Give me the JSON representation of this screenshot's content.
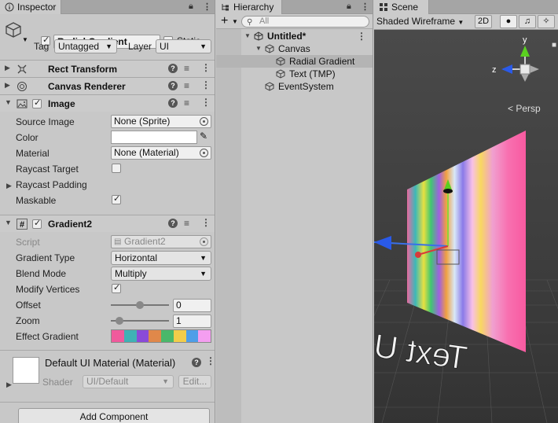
{
  "inspector": {
    "tab_label": "Inspector",
    "object_name": "Radial Gradient",
    "static_label": "Static",
    "tag_label": "Tag",
    "tag_value": "Untagged",
    "layer_label": "Layer",
    "layer_value": "UI",
    "components": [
      {
        "title": "Rect Transform",
        "expanded": false
      },
      {
        "title": "Canvas Renderer",
        "expanded": false
      },
      {
        "title": "Image",
        "expanded": true
      },
      {
        "title": "Gradient2",
        "expanded": true
      }
    ],
    "image": {
      "source_image_label": "Source Image",
      "source_image_value": "None (Sprite)",
      "color_label": "Color",
      "color_value": "#FFFFFF",
      "material_label": "Material",
      "material_value": "None (Material)",
      "raycast_target_label": "Raycast Target",
      "raycast_target_checked": false,
      "raycast_padding_label": "Raycast Padding",
      "maskable_label": "Maskable",
      "maskable_checked": true
    },
    "gradient2": {
      "script_label": "Script",
      "script_value": "Gradient2",
      "gradient_type_label": "Gradient Type",
      "gradient_type_value": "Horizontal",
      "blend_mode_label": "Blend Mode",
      "blend_mode_value": "Multiply",
      "modify_vertices_label": "Modify Vertices",
      "modify_vertices_checked": true,
      "offset_label": "Offset",
      "offset_value": "0",
      "zoom_label": "Zoom",
      "zoom_value": "1",
      "effect_gradient_label": "Effect Gradient",
      "effect_gradient_colors": [
        "#f05a9c",
        "#3fb1b5",
        "#8a4ad8",
        "#e0884a",
        "#4ab86a",
        "#f2cd4a",
        "#4d9ee8",
        "#f49ef0"
      ]
    },
    "material": {
      "title": "Default UI Material (Material)",
      "shader_label": "Shader",
      "shader_value": "UI/Default",
      "edit_label": "Edit..."
    },
    "add_component_label": "Add Component"
  },
  "hierarchy": {
    "tab_label": "Hierarchy",
    "search_placeholder": "All",
    "items": [
      {
        "label": "Untitled*",
        "depth": 0,
        "type": "scene",
        "selected": false
      },
      {
        "label": "Canvas",
        "depth": 1,
        "type": "gameobject",
        "selected": false
      },
      {
        "label": "Radial Gradient",
        "depth": 2,
        "type": "gameobject",
        "selected": true
      },
      {
        "label": "Text (TMP)",
        "depth": 2,
        "type": "gameobject",
        "selected": false
      },
      {
        "label": "EventSystem",
        "depth": 1,
        "type": "gameobject",
        "selected": false
      }
    ]
  },
  "scene": {
    "tab_label": "Scene",
    "draw_mode": "Shaded Wireframe",
    "mode_2d_label": "2D",
    "gizmo_y": "y",
    "gizmo_z": "z",
    "projection_label": "< Persp",
    "world_text": "Text UI"
  }
}
